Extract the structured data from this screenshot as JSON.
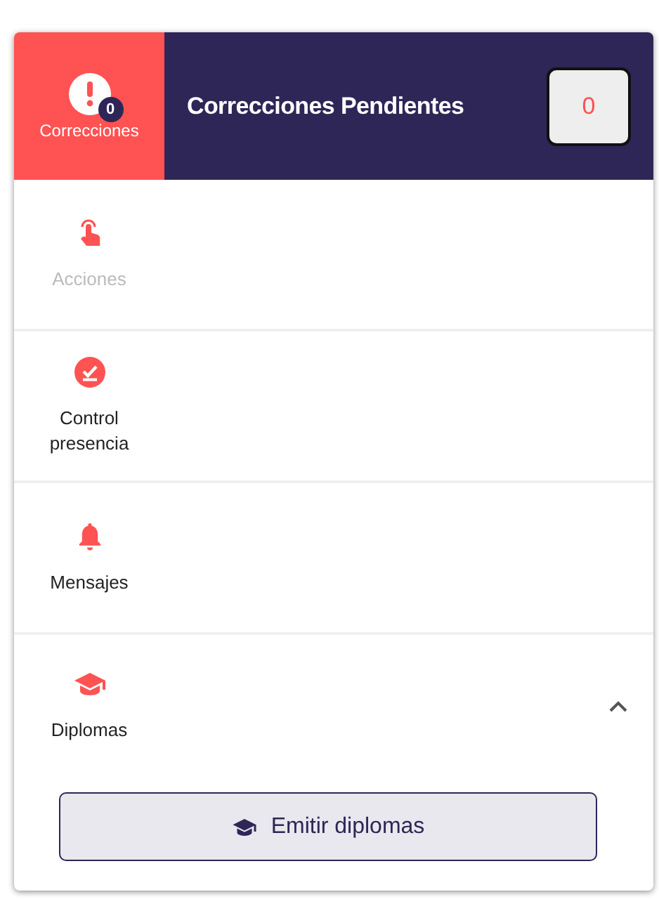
{
  "header": {
    "tab": {
      "label": "Correcciones",
      "badge": "0"
    },
    "title": "Correcciones Pendientes",
    "count": "0"
  },
  "sections": [
    {
      "kind": "touch",
      "label": "Acciones",
      "disabled": true
    },
    {
      "kind": "check",
      "label": "Control presencia",
      "disabled": false
    },
    {
      "kind": "bell",
      "label": "Mensajes",
      "disabled": false
    },
    {
      "kind": "cap",
      "label": "Diplomas",
      "disabled": false,
      "expanded": true,
      "action": {
        "label": "Emitir diplomas"
      }
    }
  ]
}
